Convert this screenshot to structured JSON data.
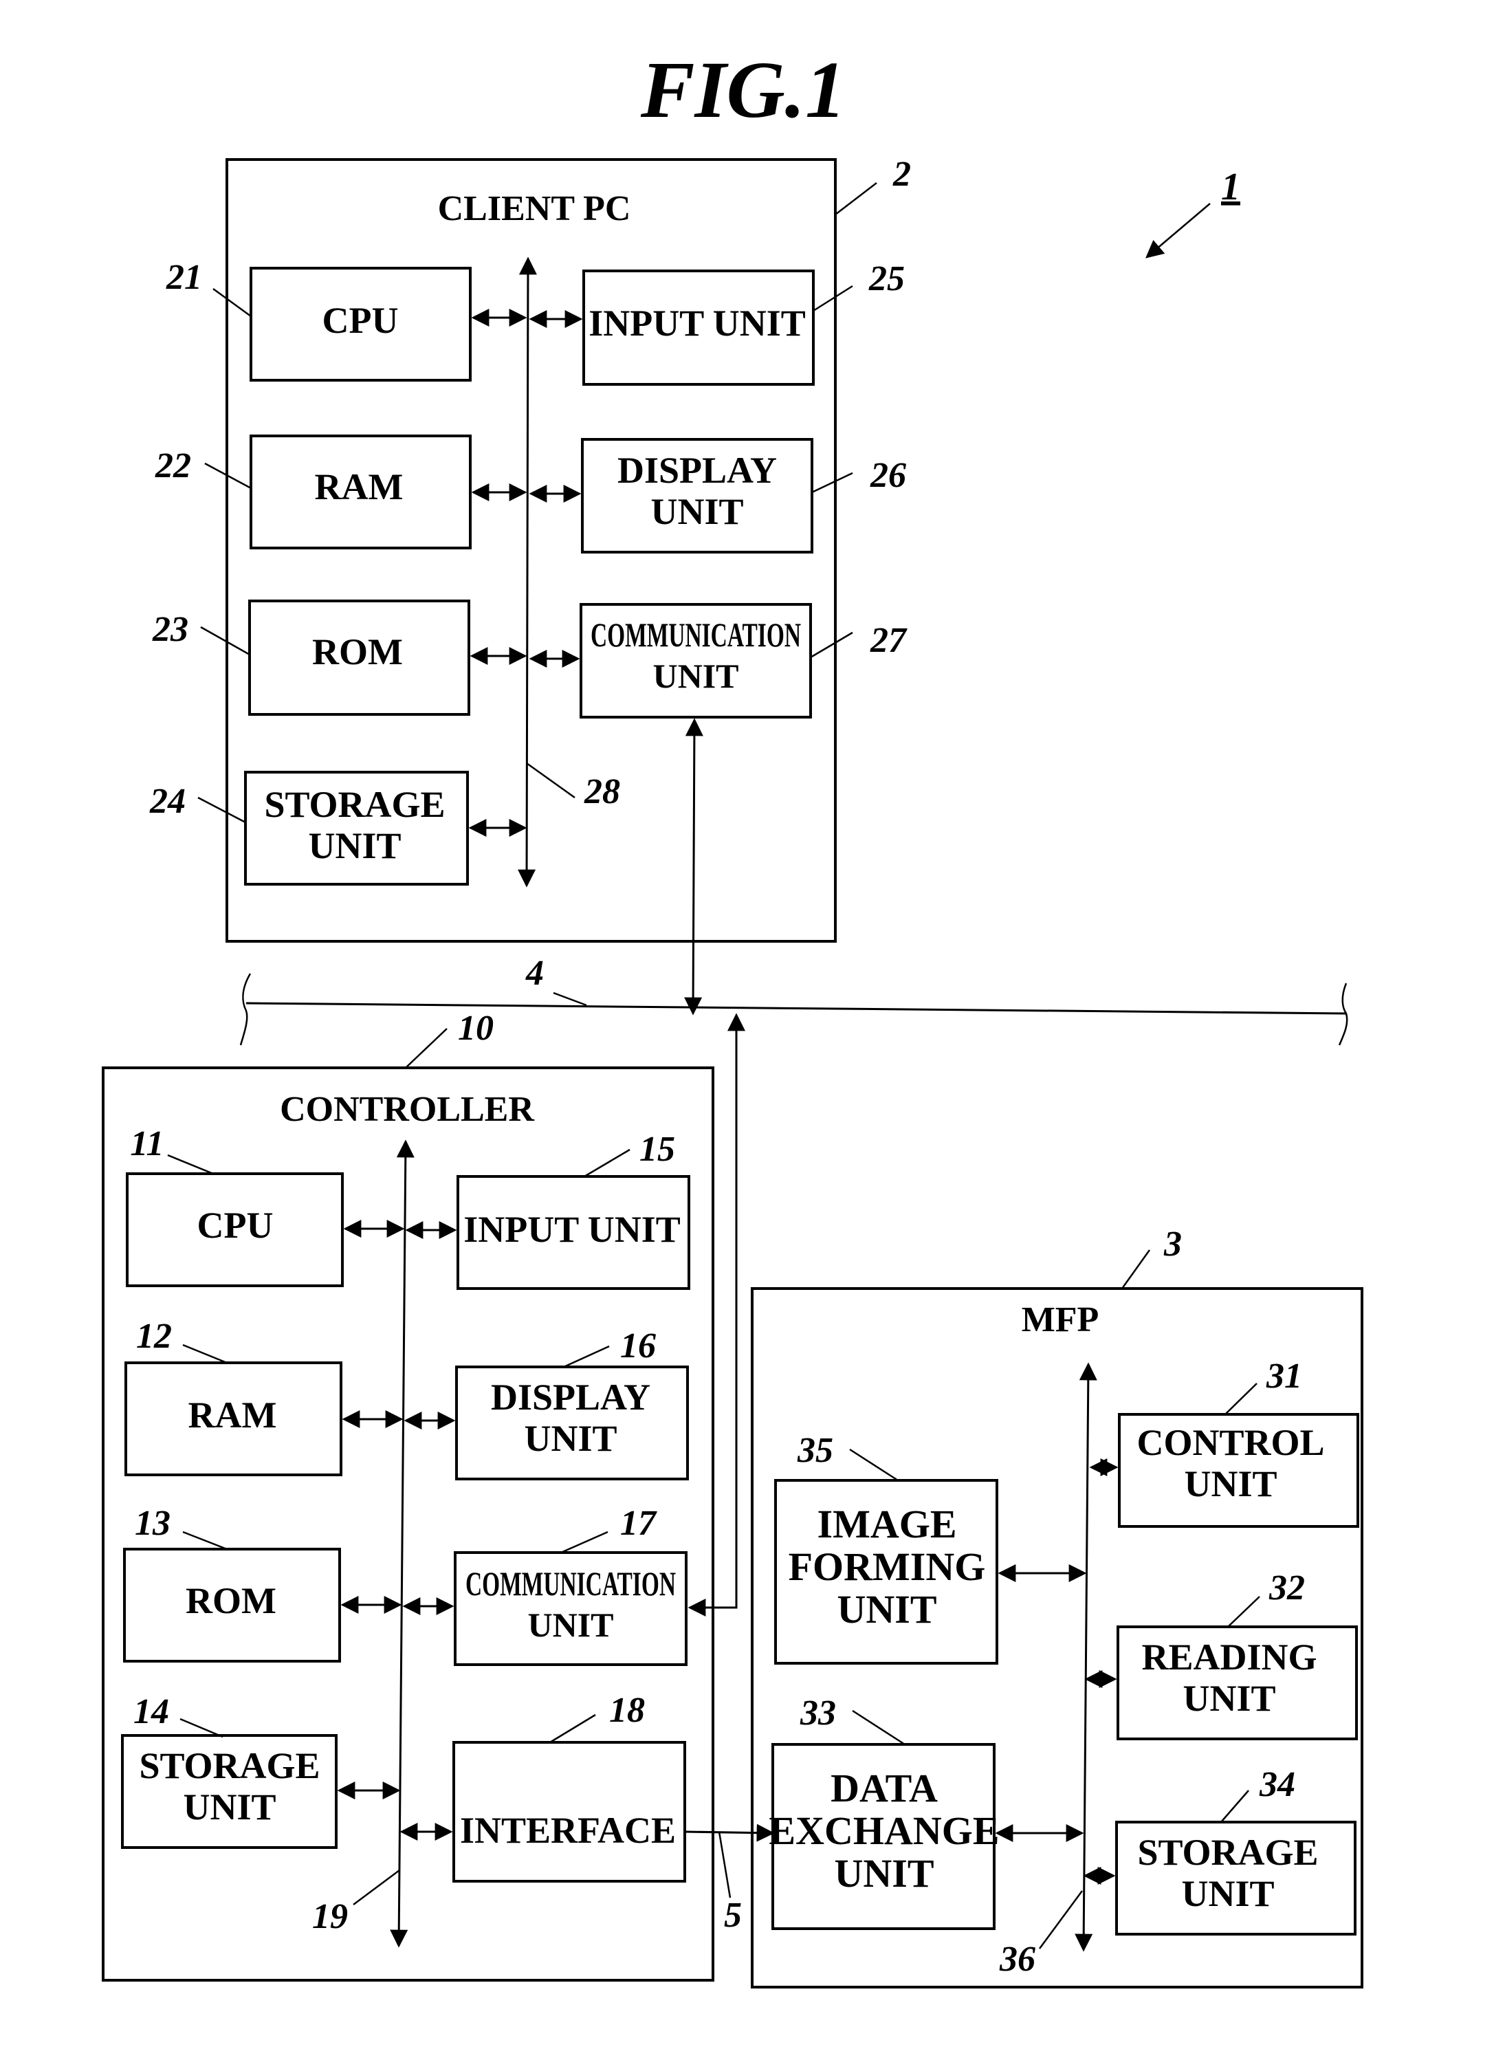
{
  "figure": {
    "title": "FIG.1",
    "system_ref": "1"
  },
  "client_pc": {
    "ref": "2",
    "title": "CLIENT PC",
    "bus_ref": "28",
    "blocks": {
      "cpu": {
        "ref": "21",
        "lines": [
          "CPU"
        ]
      },
      "ram": {
        "ref": "22",
        "lines": [
          "RAM"
        ]
      },
      "rom": {
        "ref": "23",
        "lines": [
          "ROM"
        ]
      },
      "storage": {
        "ref": "24",
        "lines": [
          "STORAGE",
          "UNIT"
        ]
      },
      "input": {
        "ref": "25",
        "lines": [
          "INPUT UNIT"
        ]
      },
      "display": {
        "ref": "26",
        "lines": [
          "DISPLAY",
          "UNIT"
        ]
      },
      "communication": {
        "ref": "27",
        "lines": [
          "COMMUNICATION",
          "UNIT"
        ]
      }
    }
  },
  "network": {
    "ref": "4"
  },
  "controller": {
    "ref": "10",
    "title": "CONTROLLER",
    "bus_ref": "19",
    "blocks": {
      "cpu": {
        "ref": "11",
        "lines": [
          "CPU"
        ]
      },
      "ram": {
        "ref": "12",
        "lines": [
          "RAM"
        ]
      },
      "rom": {
        "ref": "13",
        "lines": [
          "ROM"
        ]
      },
      "storage": {
        "ref": "14",
        "lines": [
          "STORAGE",
          "UNIT"
        ]
      },
      "input": {
        "ref": "15",
        "lines": [
          "INPUT UNIT"
        ]
      },
      "display": {
        "ref": "16",
        "lines": [
          "DISPLAY",
          "UNIT"
        ]
      },
      "communication": {
        "ref": "17",
        "lines": [
          "COMMUNICATION",
          "UNIT"
        ]
      },
      "interface": {
        "ref": "18",
        "lines": [
          "INTERFACE"
        ]
      }
    }
  },
  "link": {
    "ref": "5"
  },
  "mfp": {
    "ref": "3",
    "title": "MFP",
    "bus_ref": "36",
    "blocks": {
      "control": {
        "ref": "31",
        "lines": [
          "CONTROL",
          "UNIT"
        ]
      },
      "reading": {
        "ref": "32",
        "lines": [
          "READING",
          "UNIT"
        ]
      },
      "data_exchange": {
        "ref": "33",
        "lines": [
          "DATA",
          "EXCHANGE",
          "UNIT"
        ]
      },
      "storage": {
        "ref": "34",
        "lines": [
          "STORAGE",
          "UNIT"
        ]
      },
      "image_forming": {
        "ref": "35",
        "lines": [
          "IMAGE",
          "FORMING",
          "UNIT"
        ]
      }
    }
  }
}
